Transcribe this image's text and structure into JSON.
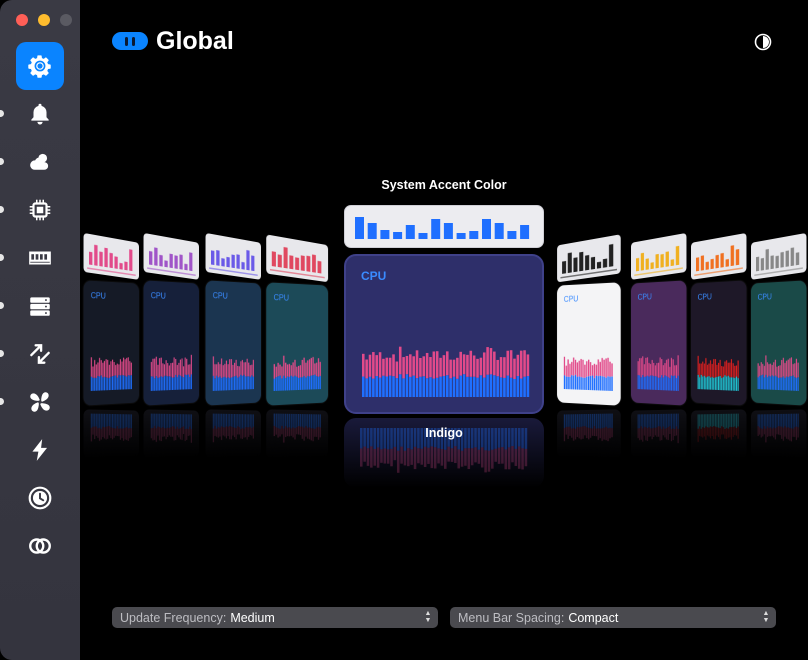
{
  "window": {
    "title": "Global"
  },
  "sidebar": {
    "items": [
      {
        "name": "general",
        "icon": "gear-icon",
        "active": true
      },
      {
        "name": "notifications",
        "icon": "bell-icon"
      },
      {
        "name": "weather",
        "icon": "cloud-sun-icon"
      },
      {
        "name": "cpu",
        "icon": "chip-icon"
      },
      {
        "name": "memory",
        "icon": "memory-icon"
      },
      {
        "name": "disk",
        "icon": "disk-stack-icon"
      },
      {
        "name": "network",
        "icon": "arrows-updown-icon"
      },
      {
        "name": "fans",
        "icon": "fan-icon"
      },
      {
        "name": "battery",
        "icon": "bolt-icon"
      },
      {
        "name": "time",
        "icon": "clock-icon"
      },
      {
        "name": "about",
        "icon": "rings-icon"
      }
    ]
  },
  "colors": {
    "accent": "#0a84ff",
    "center_card": "#2e2f6a",
    "cpu_blue": "#1f6fff",
    "cpu_pink": "#e24a8a"
  },
  "main": {
    "accent_title": "System Accent Color",
    "selected_theme": "Indigo",
    "card_label": "CPU"
  },
  "controls": {
    "update_frequency_label": "Update Frequency:",
    "update_frequency_value": "Medium",
    "menu_bar_spacing_label": "Menu Bar Spacing:",
    "menu_bar_spacing_value": "Compact"
  }
}
